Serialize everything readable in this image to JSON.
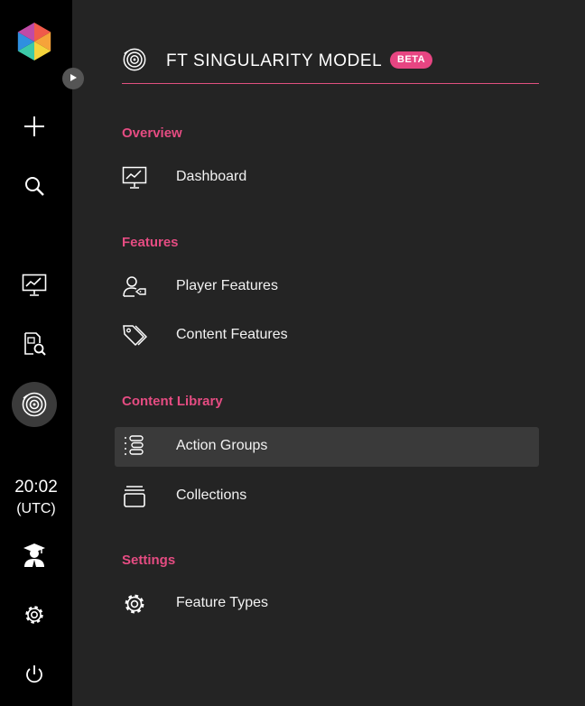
{
  "app": {
    "title": "FT SINGULARITY MODEL",
    "badge": "BETA",
    "accent_color": "#e54c82"
  },
  "rail": {
    "items": [
      {
        "name": "add",
        "icon": "plus-icon"
      },
      {
        "name": "search",
        "icon": "search-icon"
      },
      {
        "name": "dashboard",
        "icon": "monitor-chart-icon"
      },
      {
        "name": "inspect",
        "icon": "document-search-icon"
      },
      {
        "name": "singularity",
        "icon": "target-icon",
        "active": true
      },
      {
        "name": "user",
        "icon": "graduate-user-icon"
      },
      {
        "name": "settings",
        "icon": "gear-icon"
      },
      {
        "name": "logout",
        "icon": "power-icon"
      }
    ],
    "clock": {
      "time": "20:02",
      "tz": "(UTC)"
    }
  },
  "nav": {
    "overview": {
      "label": "Overview",
      "items": [
        {
          "label": "Dashboard",
          "icon": "monitor-chart-icon"
        }
      ]
    },
    "features": {
      "label": "Features",
      "items": [
        {
          "label": "Player Features",
          "icon": "user-tag-icon"
        },
        {
          "label": "Content Features",
          "icon": "tags-icon"
        }
      ]
    },
    "library": {
      "label": "Content Library",
      "items": [
        {
          "label": "Action Groups",
          "icon": "list-group-icon",
          "selected": true
        },
        {
          "label": "Collections",
          "icon": "archive-icon"
        }
      ]
    },
    "settings": {
      "label": "Settings",
      "items": [
        {
          "label": "Feature Types",
          "icon": "gear-icon"
        }
      ]
    }
  }
}
